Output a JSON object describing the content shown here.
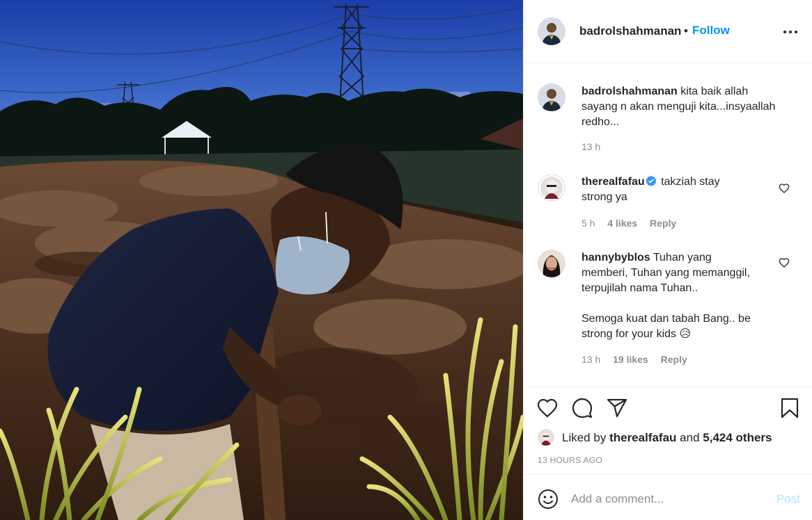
{
  "post": {
    "author": "badrolshahmanan",
    "follow_dot": "•",
    "follow_label": "Follow",
    "more_icon": "more-horizontal-icon",
    "image_alt": "Man wearing a face mask and skullcap kneeling at a fresh grave at dusk with power pylons in the background"
  },
  "comments": [
    {
      "user": "badrolshahmanan",
      "lines": [
        "kita baik allah",
        "sayang n akan menguji kita...insyaallah",
        "redho..."
      ],
      "time": "13 h",
      "likes": "",
      "reply": "",
      "verified": false
    },
    {
      "user": "therealfafau",
      "lines": [
        "takziah stay",
        "strong ya"
      ],
      "time": "5 h",
      "likes": "4 likes",
      "reply": "Reply",
      "verified": true
    },
    {
      "user": "hannybyblos",
      "lines": [
        "Tuhan yang",
        "memberi, Tuhan yang memanggil,",
        "terpujilah nama Tuhan..",
        "",
        "Semoga kuat dan tabah Bang.. be",
        "strong for your kids 😥"
      ],
      "time": "13 h",
      "likes": "19 likes",
      "reply": "Reply",
      "verified": false
    }
  ],
  "actions": {
    "icons": [
      "heart-icon",
      "comment-icon",
      "share-icon",
      "bookmark-icon"
    ],
    "liked_prefix": "Liked by",
    "liked_user": "therealfafau",
    "liked_and": "and",
    "liked_count": "5,424 others",
    "timestamp": "13 HOURS AGO"
  },
  "add_comment": {
    "placeholder": "Add a comment...",
    "post_label": "Post"
  },
  "colors": {
    "accent": "#0095f6",
    "post_disabled": "#b2dffc",
    "text": "#262626",
    "muted": "#8e8e8e",
    "divider": "#efefef"
  }
}
